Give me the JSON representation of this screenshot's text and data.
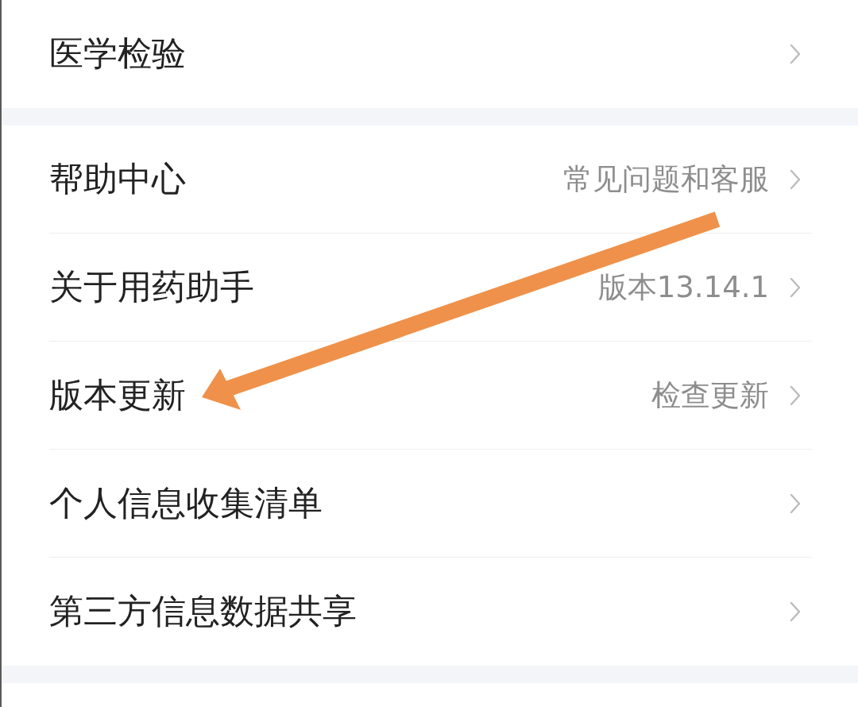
{
  "groups": [
    {
      "items": [
        {
          "label": "医学检验"
        }
      ]
    },
    {
      "items": [
        {
          "label": "帮助中心",
          "value": "常见问题和客服"
        },
        {
          "label": "关于用药助手",
          "value": "版本13.14.1"
        },
        {
          "label": "版本更新",
          "value": "检查更新"
        },
        {
          "label": "个人信息收集清单"
        },
        {
          "label": "第三方信息数据共享"
        }
      ]
    }
  ]
}
